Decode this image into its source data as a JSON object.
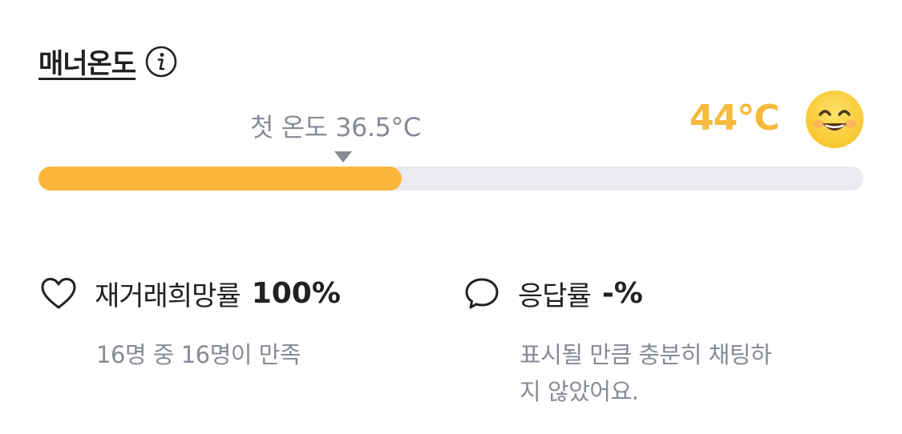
{
  "header": {
    "title": "매너온도",
    "info_icon": "info-icon"
  },
  "temperature": {
    "first_label": "첫 온도 36.5°C",
    "current": "44°C",
    "progress_percent": 44,
    "face_icon": "smiling-face-icon",
    "accent_color": "#fbb63a"
  },
  "stats": {
    "rehire": {
      "icon": "heart-icon",
      "label": "재거래희망률",
      "value": "100%",
      "description": "16명 중 16명이 만족"
    },
    "response": {
      "icon": "chat-bubble-icon",
      "label": "응답률",
      "value": "-%",
      "description_line1": "표시될 만큼 충분히 채팅하",
      "description_line2": "지 않았어요."
    }
  }
}
